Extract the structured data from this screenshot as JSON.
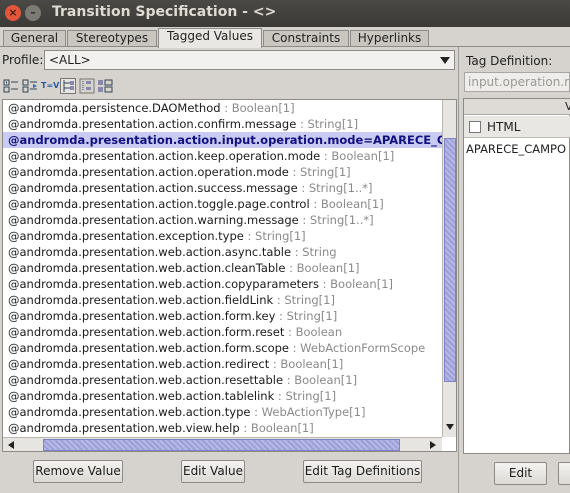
{
  "window": {
    "title": "Transition Specification - <>",
    "close_glyph": "×",
    "minimize_glyph": "–"
  },
  "tabs": [
    {
      "label": "General"
    },
    {
      "label": "Stereotypes"
    },
    {
      "label": "Tagged Values"
    },
    {
      "label": "Constraints"
    },
    {
      "label": "Hyperlinks"
    }
  ],
  "profile": {
    "label": "Profile:",
    "selected": "<ALL>"
  },
  "toolbar": {
    "icons": [
      "expand-icon",
      "collapse-icon",
      "tagged-value-icon",
      "tree-view-icon",
      "flat-view-icon",
      "grouped-view-icon"
    ],
    "tv_glyph": "T=V"
  },
  "tagged_values": [
    {
      "name": "@andromda.persistence.DAOMethod",
      "type": ": Boolean[1]"
    },
    {
      "name": "@andromda.presentation.action.confirm.message",
      "type": ": String[1]"
    },
    {
      "name": "@andromda.presentation.action.input.operation.mode=APARECE_CA",
      "type": ""
    },
    {
      "name": "@andromda.presentation.action.keep.operation.mode",
      "type": ": Boolean[1]"
    },
    {
      "name": "@andromda.presentation.action.operation.mode",
      "type": ": String[1]"
    },
    {
      "name": "@andromda.presentation.action.success.message",
      "type": ": String[1..*]"
    },
    {
      "name": "@andromda.presentation.action.toggle.page.control",
      "type": ": Boolean[1]"
    },
    {
      "name": "@andromda.presentation.action.warning.message",
      "type": ": String[1..*]"
    },
    {
      "name": "@andromda.presentation.exception.type",
      "type": ": String[1]"
    },
    {
      "name": "@andromda.presentation.web.action.async.table",
      "type": ": String"
    },
    {
      "name": "@andromda.presentation.web.action.cleanTable",
      "type": ": Boolean[1]"
    },
    {
      "name": "@andromda.presentation.web.action.copyparameters",
      "type": ": Boolean[1]"
    },
    {
      "name": "@andromda.presentation.web.action.fieldLink",
      "type": ": String[1]"
    },
    {
      "name": "@andromda.presentation.web.action.form.key",
      "type": ": String[1]"
    },
    {
      "name": "@andromda.presentation.web.action.form.reset",
      "type": ": Boolean"
    },
    {
      "name": "@andromda.presentation.web.action.form.scope",
      "type": ": WebActionFormScope"
    },
    {
      "name": "@andromda.presentation.web.action.redirect",
      "type": ": Boolean[1]"
    },
    {
      "name": "@andromda.presentation.web.action.resettable",
      "type": ": Boolean[1]"
    },
    {
      "name": "@andromda.presentation.web.action.tablelink",
      "type": ": String[1]"
    },
    {
      "name": "@andromda.presentation.web.action.type",
      "type": ": WebActionType[1]"
    },
    {
      "name": "@andromda.presentation.web.view.help",
      "type": ": Boolean[1]"
    }
  ],
  "selected_index": 2,
  "buttons": {
    "remove_value": "Remove Value",
    "edit_value": "Edit Value",
    "edit_tag_definitions": "Edit Tag Definitions",
    "edit": "Edit"
  },
  "right": {
    "tag_definition_label": "Tag Definition:",
    "tag_definition_value": "input.operation.mo",
    "header_text": "V",
    "html_label": "HTML",
    "html_checked": false,
    "value_text": "APARECE_CAMPO"
  }
}
